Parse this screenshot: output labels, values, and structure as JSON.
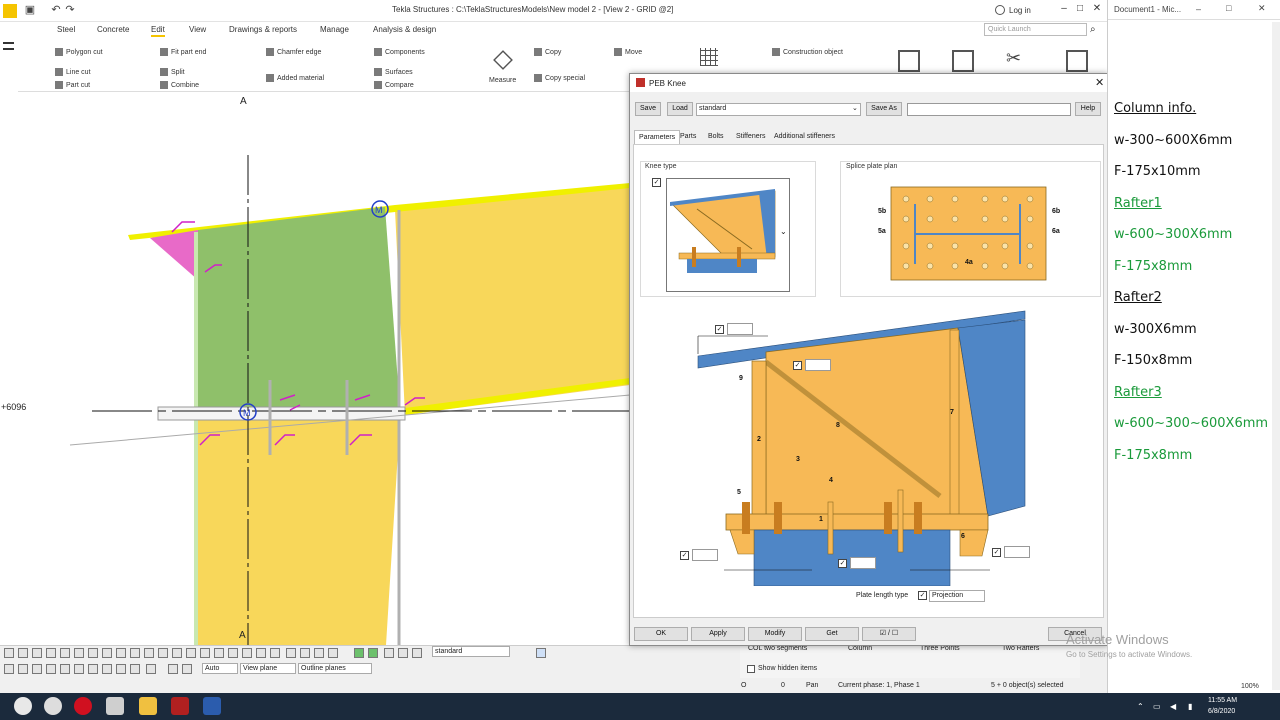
{
  "window": {
    "title": "Tekla Structures : C:\\TeklaStructuresModels\\New model 2  - [View 2 - GRID @2]",
    "login": "Log in",
    "quick_launch_placeholder": "Quick Launch",
    "minimize": "–",
    "maximize": "□",
    "close": "✕"
  },
  "menu": [
    "Steel",
    "Concrete",
    "Edit",
    "View",
    "Drawings & reports",
    "Manage",
    "Analysis & design"
  ],
  "ribbon": {
    "polygon_cut": "Polygon cut",
    "line_cut": "Line cut",
    "part_cut": "Part cut",
    "fit_part_end": "Fit part end",
    "split": "Split",
    "combine": "Combine",
    "chamfer_edge": "Chamfer edge",
    "added_material": "Added material",
    "components": "Components",
    "surfaces": "Surfaces",
    "compare": "Compare",
    "measure": "Measure",
    "copy": "Copy",
    "copy_special": "Copy special",
    "move": "Move",
    "construction_object": "Construction object"
  },
  "viewport": {
    "grid_top": "A",
    "grid_bottom": "A",
    "level": "+6096"
  },
  "bottom": {
    "standard": "standard",
    "auto": "Auto",
    "view_plane": "View plane",
    "outline_planes": "Outline planes",
    "col_two_segments": "COL two segments",
    "column": "Column",
    "three_points": "Three Points",
    "two_rafters": "Two Rafters",
    "show_hidden": "Show hidden items",
    "status_o": "O",
    "status_0": "0",
    "pan": "Pan",
    "phase": "Current phase: 1, Phase 1",
    "selected": "5 + 0 object(s) selected",
    "zoom": "100%"
  },
  "dialog": {
    "title": "PEB Knee",
    "save": "Save",
    "load": "Load",
    "preset": "standard",
    "save_as": "Save As",
    "help": "Help",
    "tabs": [
      "Parameters",
      "Parts",
      "Bolts",
      "Stiffeners",
      "Additional stiffeners"
    ],
    "knee_type": "Knee type",
    "splice_plan": "Splice plate plan",
    "splice_labels": [
      "5b",
      "5a",
      "6b",
      "6a",
      "4a"
    ],
    "diagram_labels": [
      "1",
      "2",
      "3",
      "4",
      "5",
      "6",
      "7",
      "8",
      "9"
    ],
    "plate_length_type": "Plate length type",
    "projection": "Projection",
    "ok": "OK",
    "apply": "Apply",
    "modify": "Modify",
    "get": "Get",
    "toggle": "☑ / ☐",
    "cancel": "Cancel"
  },
  "word": {
    "title": "Document1 - Mic...",
    "lines": [
      {
        "text": "Column info.",
        "color": "#111111",
        "underline": true
      },
      {
        "text": "w-300~600X6mm",
        "color": "#111111",
        "underline": false
      },
      {
        "text": "F-175x10mm",
        "color": "#111111",
        "underline": false
      },
      {
        "text": "Rafter1",
        "color": "#1a9a3a",
        "underline": true
      },
      {
        "text": "w-600~300X6mm",
        "color": "#1a9a3a",
        "underline": false
      },
      {
        "text": "F-175x8mm",
        "color": "#1a9a3a",
        "underline": false
      },
      {
        "text": "Rafter2",
        "color": "#111111",
        "underline": true
      },
      {
        "text": "w-300X6mm",
        "color": "#111111",
        "underline": false
      },
      {
        "text": "F-150x8mm",
        "color": "#111111",
        "underline": false
      },
      {
        "text": "Rafter3",
        "color": "#1a9a3a",
        "underline": true
      },
      {
        "text": "w-600~300~600X6mm",
        "color": "#1a9a3a",
        "underline": false
      },
      {
        "text": "F-175x8mm",
        "color": "#1a9a3a",
        "underline": false
      }
    ],
    "watermark": "Activate Windows",
    "watermark_sub": "Go to Settings to activate Windows."
  },
  "taskbar": {
    "time": "11:55 AM",
    "date": "6/8/2020"
  }
}
